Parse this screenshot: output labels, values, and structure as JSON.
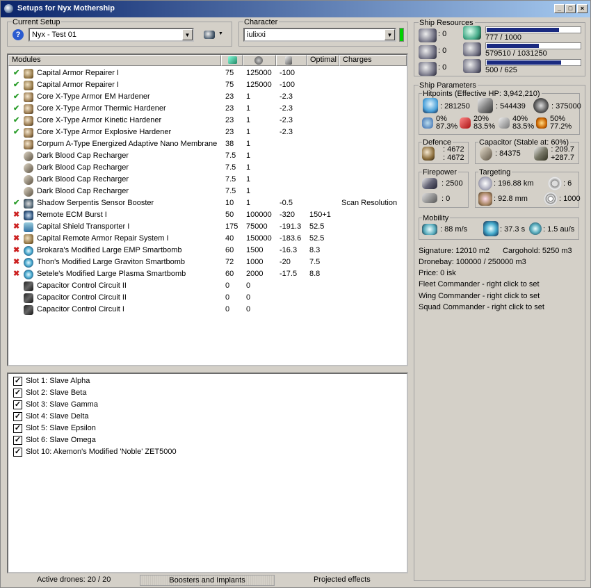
{
  "window": {
    "title": "Setups for Nyx Mothership",
    "min_label": "_",
    "max_label": "□",
    "close_label": "×"
  },
  "current_setup": {
    "legend": "Current Setup",
    "value": "Nyx - Test 01",
    "help_label": "?"
  },
  "character": {
    "legend": "Character",
    "value": "iulixxi"
  },
  "modules": {
    "headers": [
      "Modules",
      "",
      "",
      "",
      "Optimal",
      "Charges"
    ],
    "rows": [
      {
        "status": "ok",
        "icon": "armor-repairer-icon",
        "name": "Capital Armor Repairer I",
        "cpu": "75",
        "pg": "125000",
        "cap": "-100",
        "optimal": "",
        "charges": ""
      },
      {
        "status": "ok",
        "icon": "armor-repairer-icon",
        "name": "Capital Armor Repairer I",
        "cpu": "75",
        "pg": "125000",
        "cap": "-100",
        "optimal": "",
        "charges": ""
      },
      {
        "status": "ok",
        "icon": "hardener-icon",
        "name": "Core X-Type Armor EM Hardener",
        "cpu": "23",
        "pg": "1",
        "cap": "-2.3",
        "optimal": "",
        "charges": ""
      },
      {
        "status": "ok",
        "icon": "hardener-icon",
        "name": "Core X-Type Armor Thermic Hardener",
        "cpu": "23",
        "pg": "1",
        "cap": "-2.3",
        "optimal": "",
        "charges": ""
      },
      {
        "status": "ok",
        "icon": "hardener-icon",
        "name": "Core X-Type Armor Kinetic Hardener",
        "cpu": "23",
        "pg": "1",
        "cap": "-2.3",
        "optimal": "",
        "charges": ""
      },
      {
        "status": "ok",
        "icon": "hardener-icon",
        "name": "Core X-Type Armor Explosive Hardener",
        "cpu": "23",
        "pg": "1",
        "cap": "-2.3",
        "optimal": "",
        "charges": ""
      },
      {
        "status": "",
        "icon": "hardener-icon",
        "name": "Corpum A-Type Energized Adaptive Nano Membrane",
        "cpu": "38",
        "pg": "1",
        "cap": "",
        "optimal": "",
        "charges": ""
      },
      {
        "status": "",
        "icon": "cap-recharger-icon",
        "name": "Dark Blood Cap Recharger",
        "cpu": "7.5",
        "pg": "1",
        "cap": "",
        "optimal": "",
        "charges": ""
      },
      {
        "status": "",
        "icon": "cap-recharger-icon",
        "name": "Dark Blood Cap Recharger",
        "cpu": "7.5",
        "pg": "1",
        "cap": "",
        "optimal": "",
        "charges": ""
      },
      {
        "status": "",
        "icon": "cap-recharger-icon",
        "name": "Dark Blood Cap Recharger",
        "cpu": "7.5",
        "pg": "1",
        "cap": "",
        "optimal": "",
        "charges": ""
      },
      {
        "status": "",
        "icon": "cap-recharger-icon",
        "name": "Dark Blood Cap Recharger",
        "cpu": "7.5",
        "pg": "1",
        "cap": "",
        "optimal": "",
        "charges": ""
      },
      {
        "status": "ok",
        "icon": "sensor-booster-icon",
        "name": "Shadow Serpentis Sensor Booster",
        "cpu": "10",
        "pg": "1",
        "cap": "-0.5",
        "optimal": "",
        "charges": "Scan Resolution"
      },
      {
        "status": "x",
        "icon": "ecm-burst-icon",
        "name": "Remote ECM Burst I",
        "cpu": "50",
        "pg": "100000",
        "cap": "-320",
        "optimal": "150+1",
        "charges": ""
      },
      {
        "status": "x",
        "icon": "shield-transporter-icon",
        "name": "Capital Shield Transporter I",
        "cpu": "175",
        "pg": "75000",
        "cap": "-191.3",
        "optimal": "52.5",
        "charges": ""
      },
      {
        "status": "x",
        "icon": "armor-repairer-icon",
        "name": "Capital Remote Armor Repair System I",
        "cpu": "40",
        "pg": "150000",
        "cap": "-183.6",
        "optimal": "52.5",
        "charges": ""
      },
      {
        "status": "x",
        "icon": "smartbomb-icon",
        "name": "Brokara's Modified Large EMP Smartbomb",
        "cpu": "60",
        "pg": "1500",
        "cap": "-16.3",
        "optimal": "8.3",
        "charges": ""
      },
      {
        "status": "x",
        "icon": "smartbomb-icon",
        "name": "Thon's Modified Large Graviton Smartbomb",
        "cpu": "72",
        "pg": "1000",
        "cap": "-20",
        "optimal": "7.5",
        "charges": ""
      },
      {
        "status": "x",
        "icon": "smartbomb-icon",
        "name": "Setele's Modified Large Plasma Smartbomb",
        "cpu": "60",
        "pg": "2000",
        "cap": "-17.5",
        "optimal": "8.8",
        "charges": ""
      },
      {
        "status": "",
        "icon": "rig-icon",
        "name": "Capacitor Control Circuit II",
        "cpu": "0",
        "pg": "0",
        "cap": "",
        "optimal": "",
        "charges": ""
      },
      {
        "status": "",
        "icon": "rig-icon",
        "name": "Capacitor Control Circuit II",
        "cpu": "0",
        "pg": "0",
        "cap": "",
        "optimal": "",
        "charges": ""
      },
      {
        "status": "",
        "icon": "rig-icon",
        "name": "Capacitor Control Circuit I",
        "cpu": "0",
        "pg": "0",
        "cap": "",
        "optimal": "",
        "charges": ""
      }
    ]
  },
  "slots": [
    {
      "label": "Slot 1: Slave Alpha",
      "checked": true
    },
    {
      "label": "Slot 2: Slave Beta",
      "checked": true
    },
    {
      "label": "Slot 3: Slave Gamma",
      "checked": true
    },
    {
      "label": "Slot 4: Slave Delta",
      "checked": true
    },
    {
      "label": "Slot 5: Slave Epsilon",
      "checked": true
    },
    {
      "label": "Slot 6: Slave Omega",
      "checked": true
    },
    {
      "label": "Slot 10: Akemon's Modified 'Noble' ZET5000",
      "checked": true
    }
  ],
  "ship_resources": {
    "legend": "Ship Resources",
    "turret": ": 0",
    "launcher": ": 0",
    "drone": ": 0",
    "cpu_text": "777 / 1000",
    "cpu_fraction": 0.777,
    "pg_text": "579510 / 1031250",
    "pg_fraction": 0.562,
    "calib_text": "500 / 625",
    "calib_fraction": 0.8
  },
  "ship_params": {
    "legend": "Ship Parameters",
    "hitpoints": {
      "legend": "Hitpoints (Effective HP: 3,942,210)",
      "shield": ": 281250",
      "armor": ": 544439",
      "structure": ": 375000",
      "em": [
        "0%",
        "87.3%"
      ],
      "thermal": [
        "20%",
        "83.5%"
      ],
      "kinetic": [
        "40%",
        "83.5%"
      ],
      "explosive": [
        "50%",
        "77.2%"
      ]
    },
    "defence": {
      "legend": "Defence",
      "v1": ": 4672",
      "v2": ": 4672"
    },
    "capacitor": {
      "legend": "Capacitor (Stable at: 60%)",
      "value": ": 84375",
      "delta1": ": 209.7",
      "delta2": "+287.7"
    },
    "firepower": {
      "legend": "Firepower",
      "v1": ": 2500",
      "v2": ": 0"
    },
    "targeting": {
      "legend": "Targeting",
      "range": ": 196.88 km",
      "targets": ": 6",
      "scanres": ": 92.8 mm",
      "sensor": ": 1000"
    },
    "mobility": {
      "legend": "Mobility",
      "speed": ": 88 m/s",
      "align": ": 37.3 s",
      "warp": ": 1.5 au/s"
    },
    "info": [
      "Signature: 12010 m2",
      "Cargohold: 5250 m3",
      "Dronebay: 100000 / 250000 m3",
      "Price: 0 isk",
      "Fleet Commander - right click to set",
      "Wing Commander - right click to set",
      "Squad Commander - right click to set"
    ]
  },
  "status": {
    "drones": "Active drones: 20 / 20",
    "boosters": "Boosters and Implants",
    "projected": "Projected effects"
  },
  "colors": {
    "titlebar_start": "#0a246a",
    "titlebar_end": "#a6caf0",
    "bar_fill": "#1a2a80",
    "ok": "#2a9d2a",
    "fail": "#cc2020"
  }
}
